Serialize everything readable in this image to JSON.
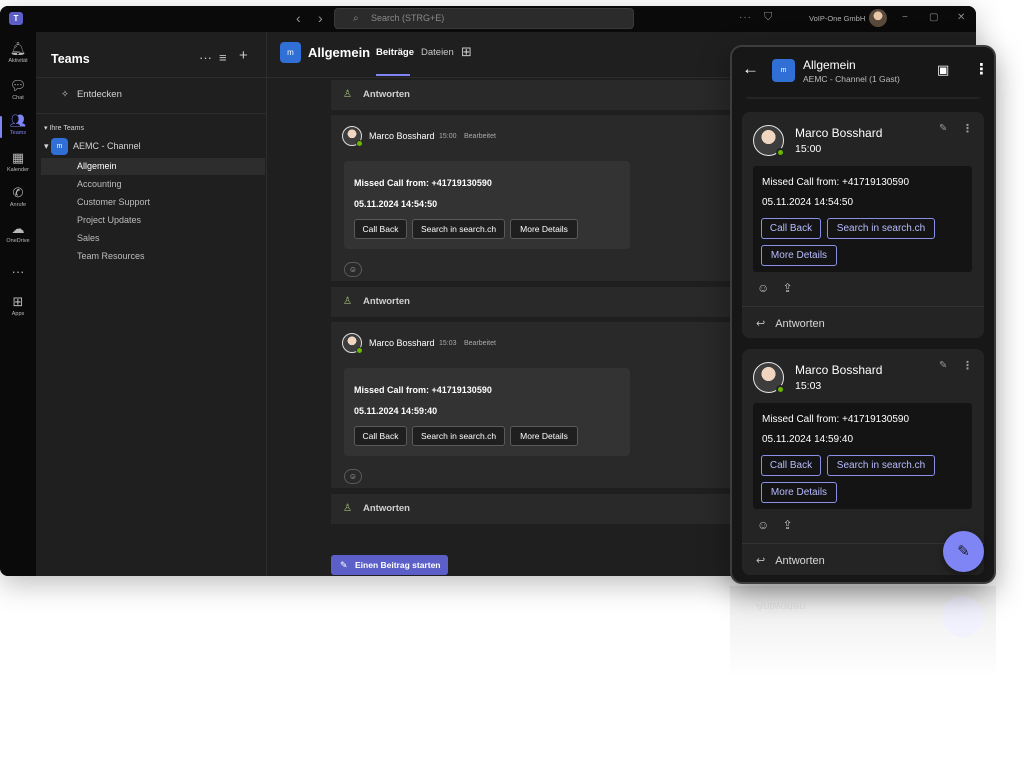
{
  "titlebar": {
    "logo": "T",
    "back": "‹",
    "forward": "›",
    "search_placeholder": "Search (STRG+E)",
    "more": "···",
    "org": "VoIP-One GmbH",
    "minimize": "−",
    "restore": "▢",
    "close": "✕"
  },
  "rail": {
    "items": [
      {
        "icon": "bell-icon",
        "glyph": "🔔︎",
        "label": "Aktivität"
      },
      {
        "icon": "chat-icon",
        "glyph": "💬︎",
        "label": "Chat"
      },
      {
        "icon": "teams-icon",
        "glyph": "👥︎",
        "label": "Teams"
      },
      {
        "icon": "calendar-icon",
        "glyph": "▦",
        "label": "Kalender"
      },
      {
        "icon": "phone-icon",
        "glyph": "✆",
        "label": "Anrufe"
      },
      {
        "icon": "cloud-icon",
        "glyph": "☁",
        "label": "OneDrive"
      }
    ],
    "more": "···",
    "apps_glyph": "⊞",
    "apps_label": "Apps"
  },
  "teams_list": {
    "title": "Teams",
    "more": "···",
    "filter": "≡",
    "add": "+",
    "discover_glyph": "✧",
    "discover": "Entdecken",
    "your_teams": "Ihre Teams",
    "team_badge": "m",
    "team_name": "AEMC - Channel",
    "channels": [
      "Allgemein",
      "Accounting",
      "Customer Support",
      "Project Updates",
      "Sales",
      "Team Resources"
    ]
  },
  "main": {
    "badge": "m",
    "title": "Allgemein",
    "tabs": [
      "Beiträge",
      "Dateien"
    ],
    "tab_add": "⊞",
    "reply_label": "Antworten",
    "posts": [
      {
        "author": "Marco Bosshard",
        "time": "15:00",
        "edited": "Bearbeitet",
        "line1": "Missed Call from: +41719130590",
        "line2": "05.11.2024 14:54:50"
      },
      {
        "author": "Marco Bosshard",
        "time": "15:03",
        "edited": "Bearbeitet",
        "line1": "Missed Call from: +41719130590",
        "line2": "05.11.2024 14:59:40"
      }
    ],
    "buttons": [
      "Call Back",
      "Search in search.ch",
      "More Details"
    ],
    "react_glyph": "☺",
    "start_post": "Einen Beitrag starten",
    "start_glyph": "✎"
  },
  "phone": {
    "back": "←",
    "badge": "m",
    "title": "Allgemein",
    "subtitle": "AEMC - Channel (1 Gast)",
    "video_glyph": "▣",
    "more": "⋮",
    "cards": [
      {
        "author": "Marco Bosshard",
        "time": "15:00",
        "line1": "Missed Call from: +41719130590",
        "line2": "05.11.2024 14:54:50"
      },
      {
        "author": "Marco Bosshard",
        "time": "15:03",
        "line1": "Missed Call from: +41719130590",
        "line2": "05.11.2024 14:59:40"
      }
    ],
    "buttons": [
      "Call Back",
      "Search in search.ch",
      "More Details"
    ],
    "edit_glyph": "✎",
    "card_more": "⋮",
    "react_glyph": "☺",
    "share_glyph": "⇪",
    "reply_glyph": "↩",
    "reply_label": "Antworten",
    "fab_glyph": "✎"
  },
  "reflection": {
    "reply_label": "Antworten"
  }
}
